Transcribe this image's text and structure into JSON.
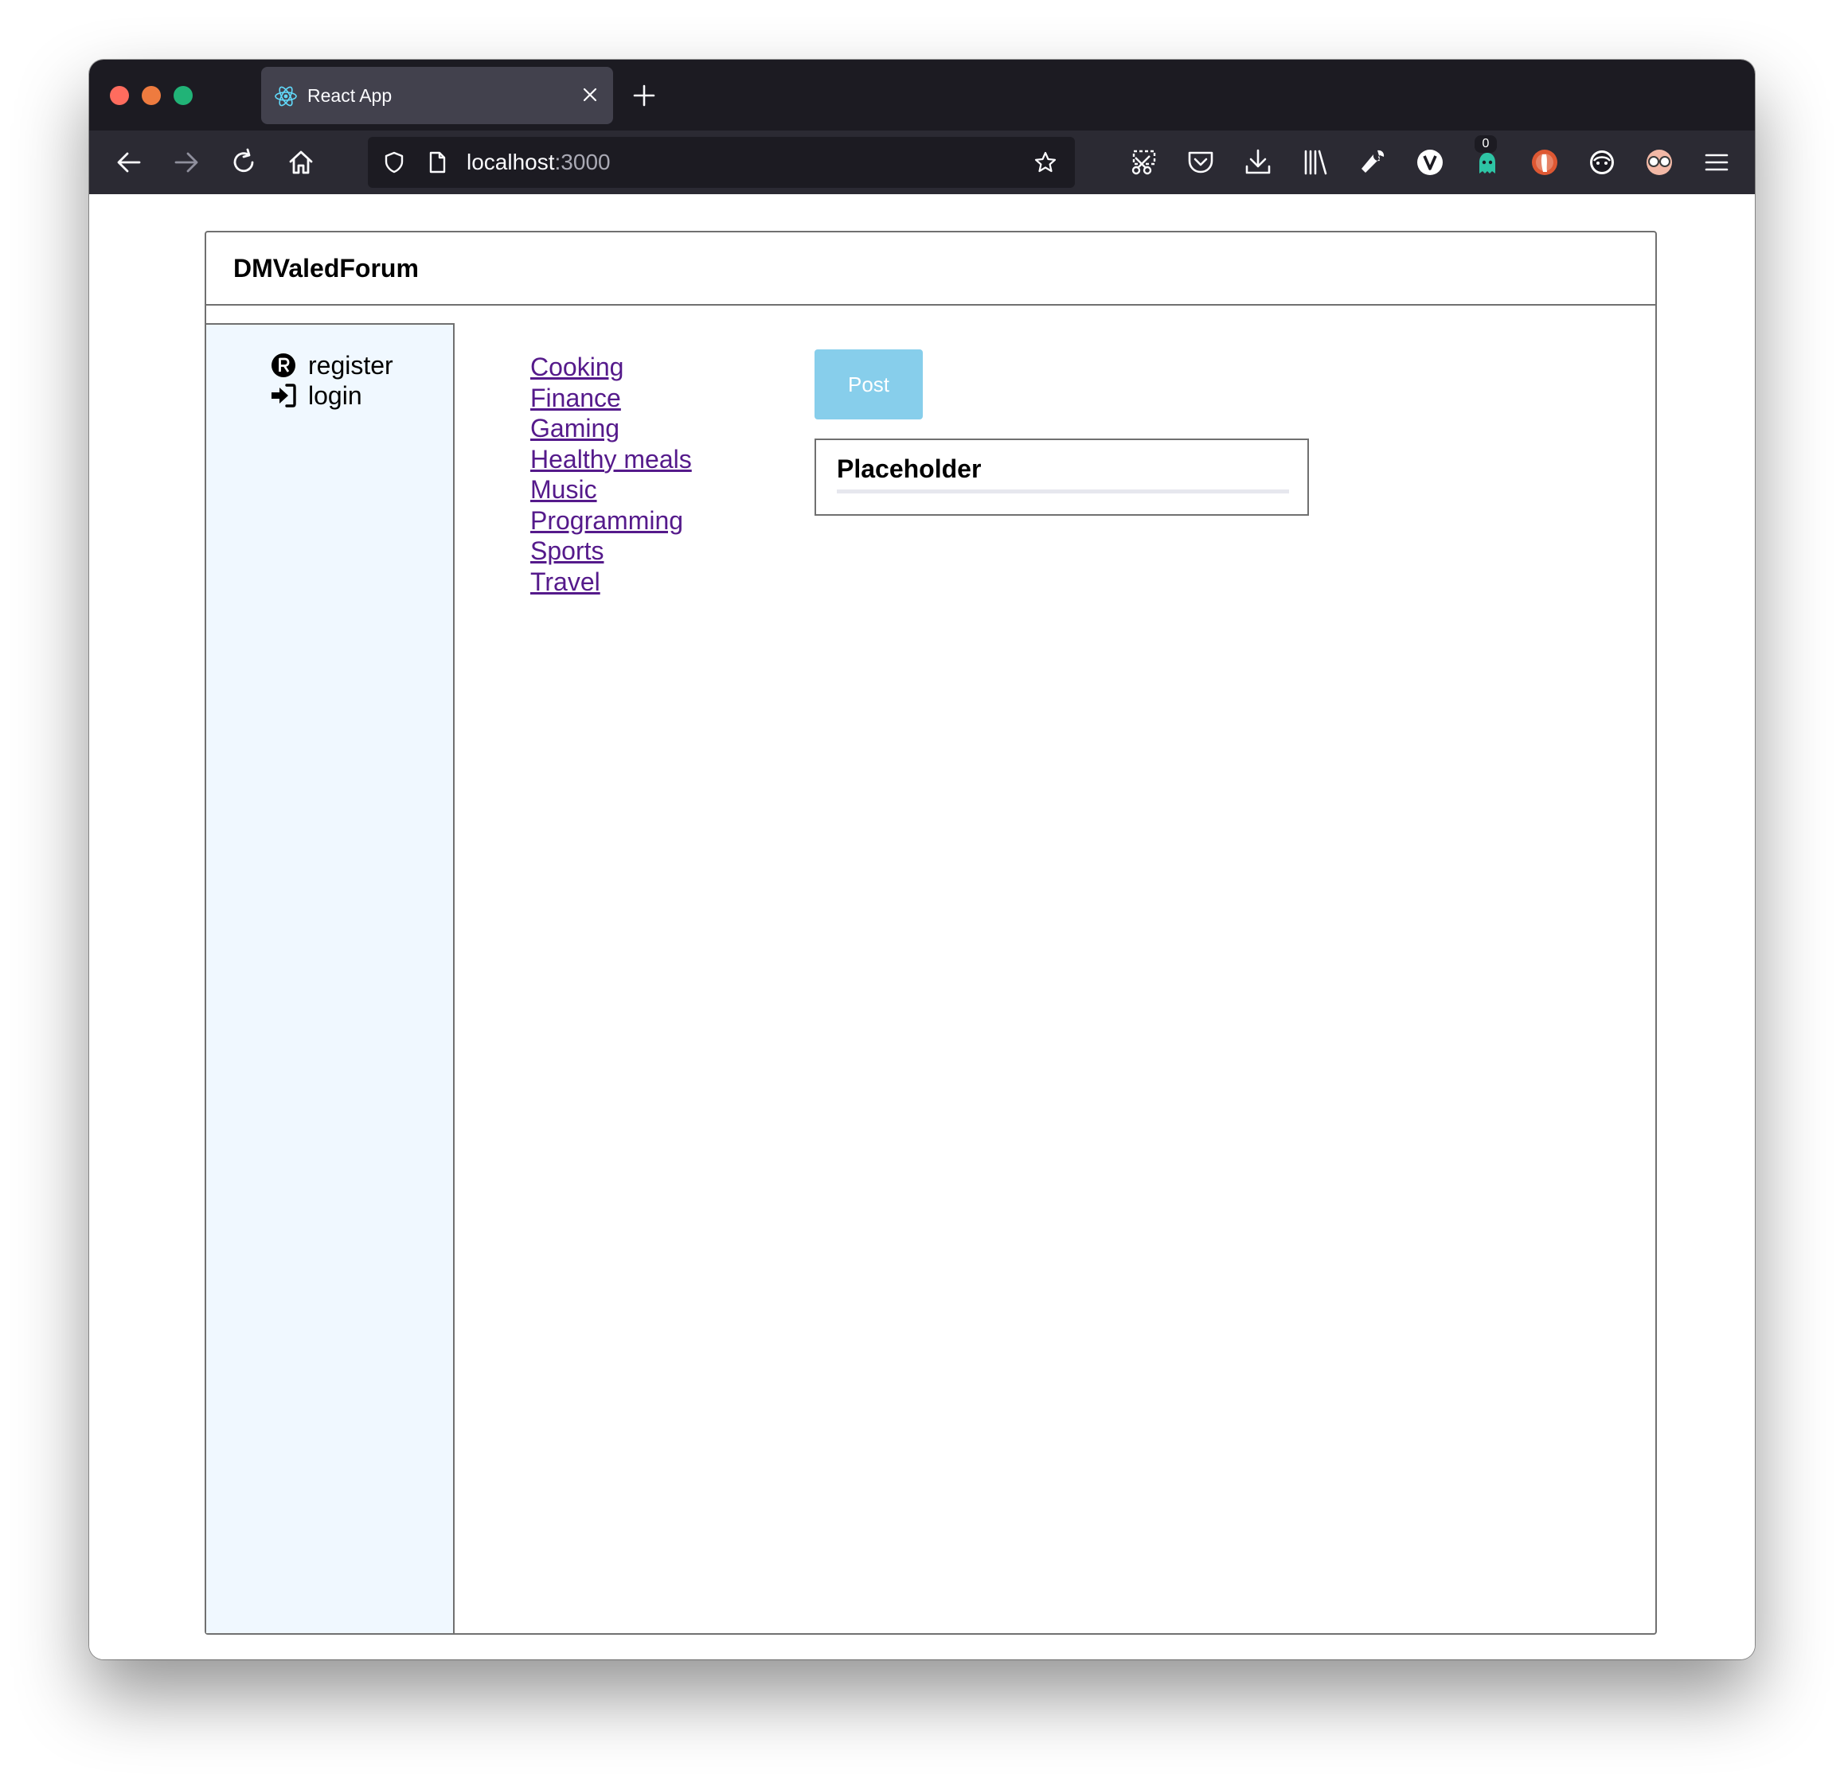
{
  "browser": {
    "tab": {
      "title": "React App",
      "favicon": "react-logo-icon"
    },
    "url": {
      "host": "localhost",
      "port": ":3000"
    },
    "toolbar_icons": [
      "back-icon",
      "forward-icon",
      "reload-icon",
      "home-icon",
      "shield-icon",
      "page-icon",
      "bookmark-star-icon",
      "screenshot-icon",
      "pocket-icon",
      "download-icon",
      "library-icon",
      "wrench-icon",
      "extension-v-icon",
      "extension-ghost-icon",
      "extension-duckduckgo-icon",
      "extension-face-icon",
      "extension-glasses-icon",
      "menu-icon"
    ],
    "extension_badge": "0"
  },
  "app": {
    "title": "DMValedForum",
    "sidebar": {
      "items": [
        {
          "label": "register",
          "icon": "registered-icon"
        },
        {
          "label": "login",
          "icon": "sign-in-icon"
        }
      ]
    },
    "categories": [
      "Cooking",
      "Finance",
      "Gaming",
      "Healthy meals",
      "Music",
      "Programming",
      "Sports",
      "Travel"
    ],
    "post_button_label": "Post",
    "post_card": {
      "title": "Placeholder"
    }
  },
  "colors": {
    "sidebar_bg": "#f0f8ff",
    "post_button_bg": "#87ceeb",
    "link": "#551a8b",
    "border": "#707070"
  }
}
